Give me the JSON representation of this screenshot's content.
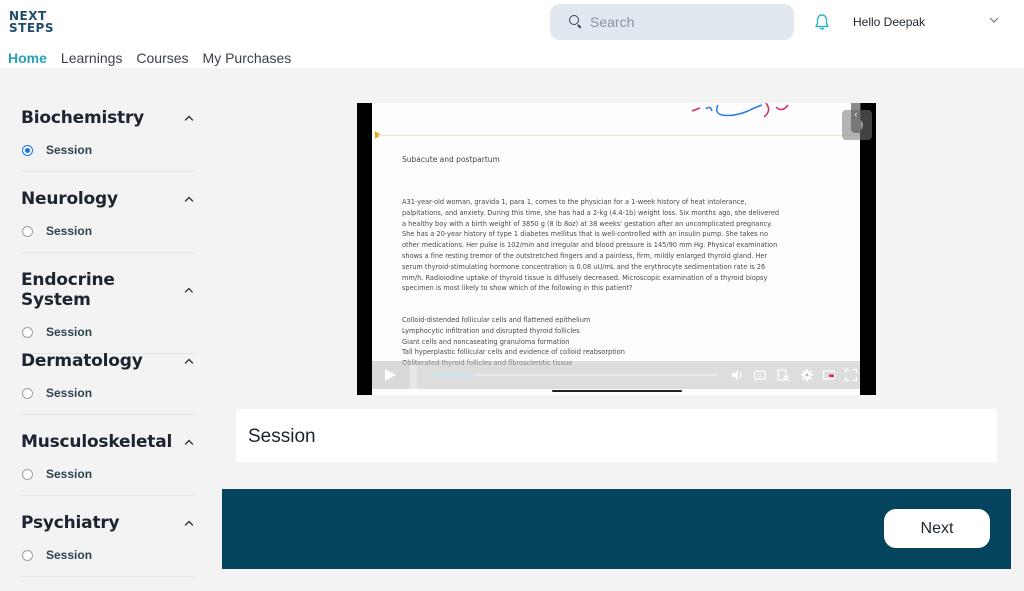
{
  "brand": {
    "logo_line1": "NEXT",
    "logo_line2": "STEPS"
  },
  "nav": {
    "items": [
      {
        "label": "Home",
        "active": true
      },
      {
        "label": "Learnings",
        "active": false
      },
      {
        "label": "Courses",
        "active": false
      },
      {
        "label": "My Purchases",
        "active": false
      }
    ]
  },
  "header": {
    "search_placeholder": "Search",
    "search_value": "",
    "greeting": "Hello Deepak",
    "icons": [
      "search-icon",
      "bell-icon",
      "chevron-down-icon"
    ]
  },
  "sidebar": {
    "sections": [
      {
        "title": "Biochemistry",
        "expanded": true,
        "item": "Session",
        "selected": true
      },
      {
        "title": "Neurology",
        "expanded": true,
        "item": "Session",
        "selected": false
      },
      {
        "title": "Endocrine System",
        "expanded": true,
        "item": "Session",
        "selected": false
      },
      {
        "title": "Dermatology",
        "expanded": true,
        "item": "Session",
        "selected": false
      },
      {
        "title": "Musculoskeletal",
        "expanded": true,
        "item": "Session",
        "selected": false
      },
      {
        "title": "Psychiatry",
        "expanded": true,
        "item": "Session",
        "selected": false
      }
    ]
  },
  "video": {
    "slide_heading": "Subacute and postpartum",
    "slide_body": "A31-year-old woman, gravida 1, para 1, comes to the physician for a 1-week history of heat intolerance, palpitations, and anxiety. During this time, she has had a 2-kg (4.4-1b) weight loss. Six months ago, she delivered a healthy boy with a birth weight of 3850 g (8 lb 8oz) at 38 weeks' gestation after an uncomplicated pregnancy. She has a 20-year history of type 1 diabetes mellitus that is well-controlled with an insulin pump. She takes no other medications. Her pulse is 102/min and irregular and blood pressure is 145/90 mm Hg. Physical examination shows a fine resting tremor of the outstretched fingers and a painless, firm, mildly enlarged thyroid gland. Her serum thyroid-stimulating hormone concentration is 0.08 uU/mL and the erythrocyte sedimentation rate is 26 mm/h. Radioiodine uptake of thyroid tissue is diffusely decreased. Microscopic examination of a thyroid biopsy specimen is most likely to show which of the following in this patient?",
    "options": [
      "Colloid-distended follicular cells and flattened epithelium",
      "Lymphocytic infiltration and disrupted thyroid follicles",
      "Giant cells and noncaseating granuloma formation",
      "Tall hyperplastic follicular cells and evidence of colloid reabsorption",
      "Obliterated thyroid follicles and fibrosclerotic tissue"
    ],
    "progress_fraction": 0.04,
    "controls": [
      "play-icon",
      "volume-icon",
      "captions-icon",
      "transcript-icon",
      "settings-icon",
      "miniplayer-icon",
      "fullscreen-icon"
    ],
    "accent_colors": {
      "marker": "#e6a817",
      "progress": "#c9e8f7"
    }
  },
  "content": {
    "title": "Session",
    "next_label": "Next"
  },
  "colors": {
    "brand_teal": "#2a9fb8",
    "footer_bar": "#06445e",
    "radio_selected": "#1a73e8"
  }
}
